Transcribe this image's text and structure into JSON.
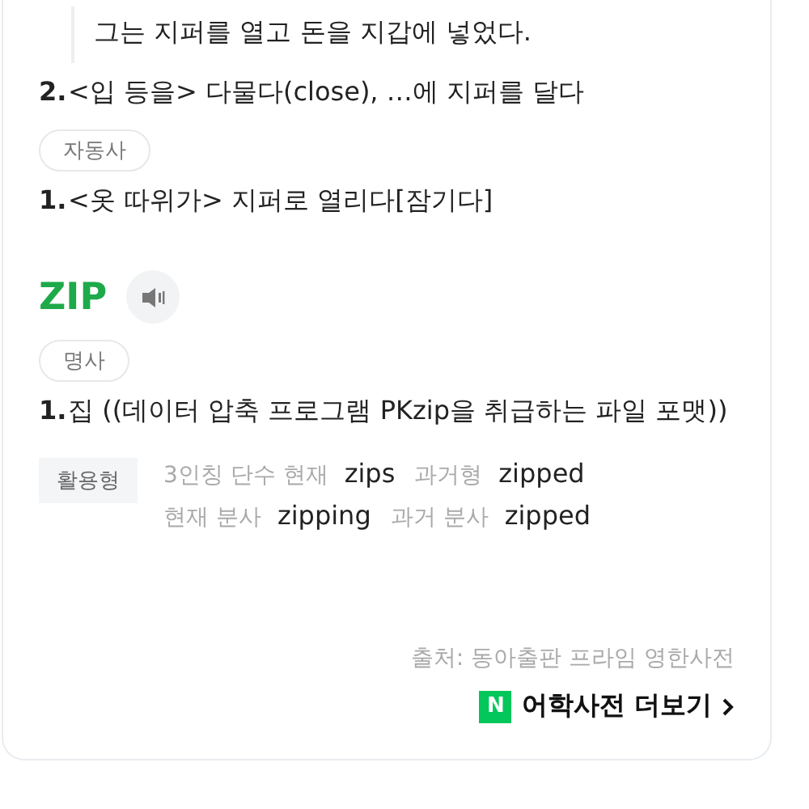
{
  "example": {
    "translation": "그는 지퍼를 열고 돈을 지갑에 넣었다."
  },
  "senses_top": [
    {
      "number": "2.",
      "text": "<입 등을> 다물다(close), …에 지퍼를 달다"
    }
  ],
  "sections": [
    {
      "pos": "자동사",
      "senses": [
        {
          "number": "1.",
          "text": "<옷 따위가> 지퍼로 열리다[잠기다]"
        }
      ]
    }
  ],
  "entry": {
    "word": "ZIP",
    "pos": "명사",
    "senses": [
      {
        "number": "1.",
        "text": "집 ((데이터 압축 프로그램 PKzip을 취급하는 파일 포맷))"
      }
    ]
  },
  "inflections": {
    "label": "활용형",
    "rows": [
      [
        {
          "label": "3인칭 단수 현재",
          "form": "zips"
        },
        {
          "label": "과거형",
          "form": "zipped"
        }
      ],
      [
        {
          "label": "현재 분사",
          "form": "zipping"
        },
        {
          "label": "과거 분사",
          "form": "zipped"
        }
      ]
    ]
  },
  "source": "출처: 동아출판 프라임 영한사전",
  "more_link": {
    "badge": "N",
    "label": "어학사전 더보기"
  }
}
